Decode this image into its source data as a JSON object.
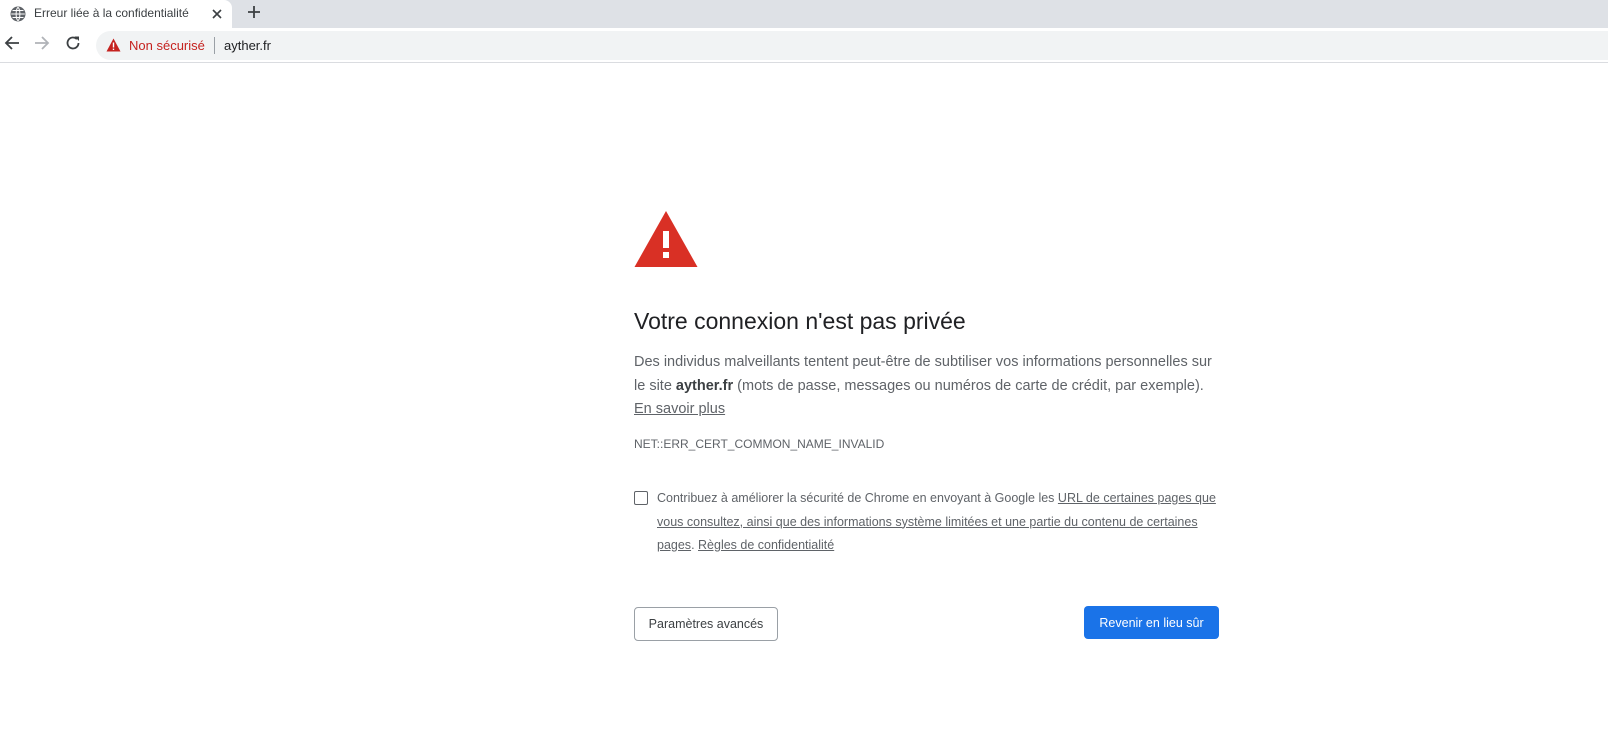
{
  "browser": {
    "tab": {
      "title": "Erreur liée à la confidentialité",
      "favicon_icon": "globe-icon",
      "close_icon": "close-icon"
    },
    "new_tab_icon": "plus-icon",
    "nav": {
      "back_icon": "arrow-left-icon",
      "forward_icon": "arrow-right-icon",
      "reload_icon": "reload-icon"
    },
    "omnibox": {
      "security_icon": "warning-triangle-icon",
      "security_label": "Non sécurisé",
      "url": "ayther.fr"
    }
  },
  "interstitial": {
    "warning_icon": "warning-triangle-icon",
    "heading": "Votre connexion n'est pas privée",
    "message": {
      "before_host": "Des individus malveillants tentent peut-être de subtiliser vos informations personnelles sur le site ",
      "host": "ayther.fr",
      "after_host": " (mots de passe, messages ou numéros de carte de crédit, par exemple). ",
      "learn_more": "En savoir plus"
    },
    "error_code": "NET::ERR_CERT_COMMON_NAME_INVALID",
    "optin": {
      "checked": false,
      "text_before": "Contribuez à améliorer la sécurité de Chrome en envoyant à Google les ",
      "link_1": "URL de certaines pages que vous consultez, ainsi que des informations système limitées et une partie du contenu de certaines pages",
      "separator": ". ",
      "link_2": "Règles de confidentialité"
    },
    "buttons": {
      "advanced": "Paramètres avancés",
      "back_to_safety": "Revenir en lieu sûr"
    }
  },
  "colors": {
    "danger": "#d93025",
    "primary": "#1a73e8",
    "insecure_text": "#c5221f"
  }
}
